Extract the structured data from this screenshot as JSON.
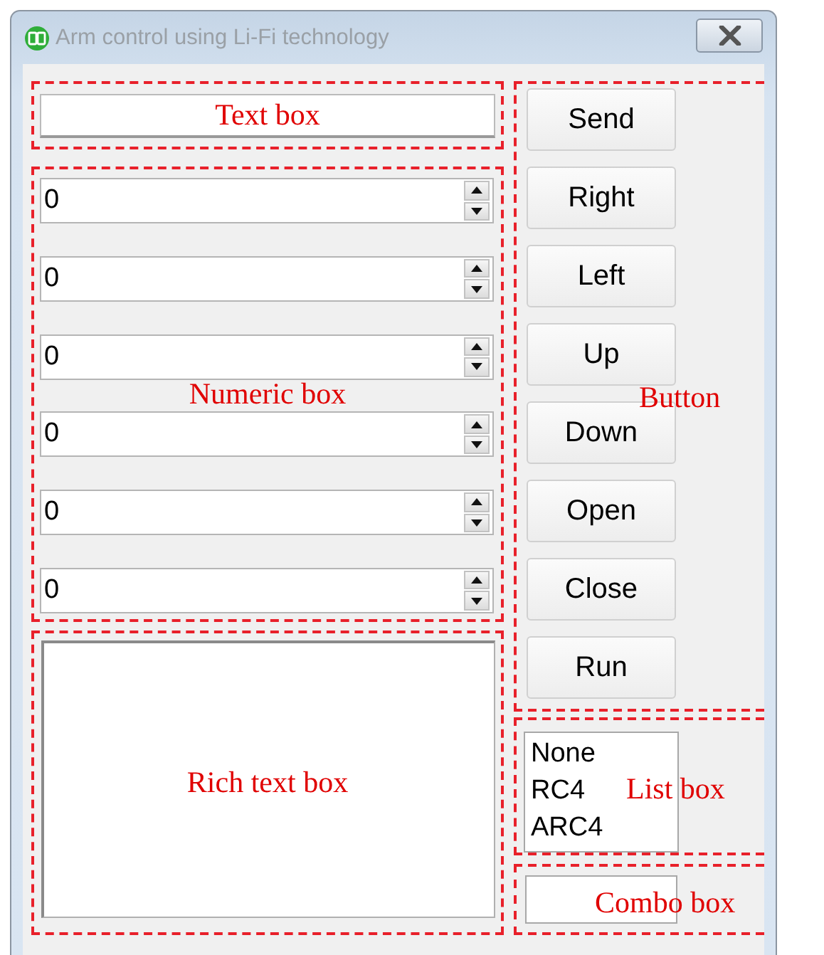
{
  "window": {
    "title": "Arm control using Li-Fi technology"
  },
  "left_regions": [
    {
      "kind": "text_box",
      "label": "Text box"
    },
    {
      "kind": "numeric_box",
      "label": "Numeric box",
      "values": [
        "0",
        "0",
        "0",
        "0",
        "0",
        "0"
      ]
    },
    {
      "kind": "rich_text_box",
      "label": "Rich text box"
    }
  ],
  "right_regions": [
    {
      "kind": "button",
      "label": "Button",
      "buttons": [
        "Send",
        "Right",
        "Left",
        "Up",
        "Down",
        "Open",
        "Close",
        "Run"
      ]
    },
    {
      "kind": "list_box",
      "label": "List box",
      "items": [
        "None",
        "RC4",
        "ARC4"
      ]
    },
    {
      "kind": "combo_box",
      "label": "Combo box"
    }
  ]
}
